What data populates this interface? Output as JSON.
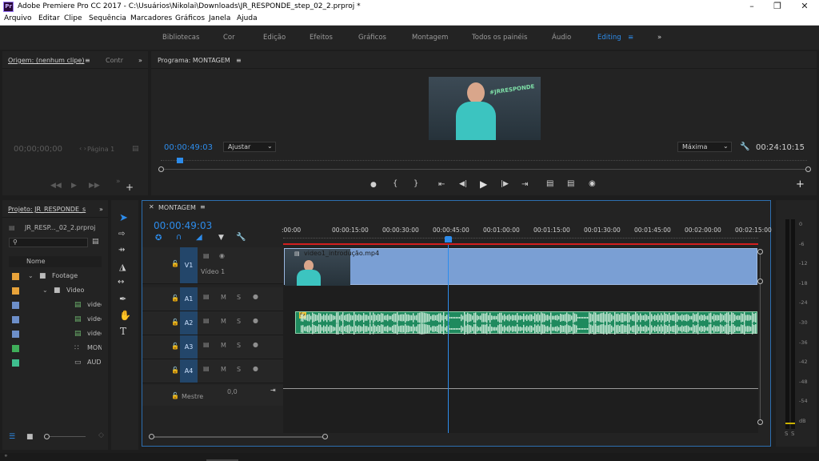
{
  "window": {
    "title": "Adobe Premiere Pro CC 2017 - C:\\Usuários\\Nikolai\\Downloads\\JR_RESPONDE_step_02_2.prproj *",
    "app_icon": "Pr"
  },
  "menu": [
    "Arquivo",
    "Editar",
    "Clipe",
    "Sequência",
    "Marcadores",
    "Gráficos",
    "Janela",
    "Ajuda"
  ],
  "workspaces": {
    "items": [
      "Bibliotecas",
      "Cor",
      "Edição",
      "Efeitos",
      "Gráficos",
      "Montagem",
      "Todos os painéis",
      "Áudio",
      "Editing"
    ],
    "active": "Editing"
  },
  "source_monitor": {
    "tab_label": "Origem: (nenhum clipe)",
    "tab2_label": "Contr",
    "timecode": "00;00;00;00",
    "page": "Página 1"
  },
  "program_monitor": {
    "tab_label": "Programa: MONTAGEM",
    "timecode": "00:00:49:03",
    "fit": "Ajustar",
    "quality": "Máxima",
    "duration": "00:24:10:15",
    "video_overlay_text": "#JRRESPONDE"
  },
  "project": {
    "tab_label": "Projeto: JR_RESPONDE_s",
    "file_name": "JR_RESP..._02_2.prproj",
    "column_name": "Nome",
    "items": [
      {
        "label": "Footage",
        "type": "folder",
        "indent": 0,
        "color": "#e8a33a"
      },
      {
        "label": "Video",
        "type": "folder",
        "indent": 1,
        "color": "#e8a33a"
      },
      {
        "label": "video",
        "type": "clip",
        "indent": 2,
        "color": "#6d8fc9"
      },
      {
        "label": "video",
        "type": "clip",
        "indent": 2,
        "color": "#6d8fc9"
      },
      {
        "label": "video",
        "type": "clip",
        "indent": 2,
        "color": "#6d8fc9"
      },
      {
        "label": "MONTAGE",
        "type": "sequence",
        "indent": 2,
        "color": "#3fae5a"
      },
      {
        "label": "AUDIO_BI",
        "type": "audio",
        "indent": 2,
        "color": "#3fbf8f"
      }
    ]
  },
  "timeline": {
    "tab_label": "MONTAGEM",
    "timecode": "00:00:49:03",
    "ruler_labels": [
      ":00:00",
      "00:00:15:00",
      "00:00:30:00",
      "00:00:45:00",
      "00:01:00:00",
      "00:01:15:00",
      "00:01:30:00",
      "00:01:45:00",
      "00:02:00:00",
      "00:02:15:00"
    ],
    "video_tracks": [
      {
        "id": "V1",
        "name": "Vídeo 1"
      }
    ],
    "audio_tracks": [
      "A1",
      "A2",
      "A3",
      "A4"
    ],
    "master_label": "Mestre",
    "master_value": "0,0",
    "video_clip_name": "video1_introdução.mp4",
    "playhead_time": "00:00:49:03"
  },
  "audio_meter": {
    "labels": [
      "0",
      "-6",
      "-12",
      "-18",
      "-24",
      "-30",
      "-36",
      "-42",
      "-48",
      "-54",
      "dB"
    ],
    "solo_labels": [
      "S",
      "S"
    ]
  },
  "colors": {
    "accent": "#2d8ceb",
    "video_clip": "#7a9fd4",
    "audio_clip": "#1f8a5e",
    "playhead": "#2d8ceb",
    "work_area": "#d21f1f"
  }
}
